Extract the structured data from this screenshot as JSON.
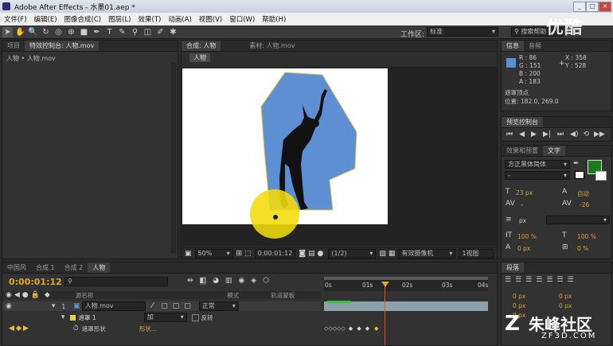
{
  "app": {
    "title": "Adobe After Effects - 水墨01.aep *"
  },
  "menu": [
    "文件(F)",
    "编辑(E)",
    "图像合成(C)",
    "图层(L)",
    "效果(T)",
    "动画(A)",
    "视图(V)",
    "窗口(W)",
    "帮助(H)"
  ],
  "toolbar": {
    "workspace_label": "工作区:",
    "workspace_value": "标准",
    "search_placeholder": "搜索帮助"
  },
  "project": {
    "tab_project": "项目",
    "tab_effects": "特效控制台: 人物.mov",
    "breadcrumb": "人物 • 人物.mov"
  },
  "composition": {
    "tab_comp": "合成: 人物",
    "tab_footage": "素材: 人物.mov",
    "comp_label": "人物",
    "zoom": "50%",
    "timecode": "0:00:01:12",
    "resolution": "(1/2)",
    "camera": "有效摄像机",
    "views": "1视图"
  },
  "info": {
    "tab_info": "信息",
    "tab_audio": "音频",
    "r": "R : 86",
    "g": "G : 151",
    "b": "B : 200",
    "a": "A : 183",
    "x": "X : 358",
    "y": "Y : 528",
    "status_title": "遮罩顶点",
    "status_pos": "位置: 182.0, 269.0",
    "swatch_color": "#5a8fd6"
  },
  "preview": {
    "title": "预览控制台"
  },
  "character": {
    "tab_effects": "效果和预置",
    "tab_text": "文字",
    "font": "方正黑体简体",
    "style": "-",
    "size": "23 px",
    "leading": "自动",
    "kerning": "-",
    "tracking": "-26",
    "unit": "px",
    "vscale": "100 %",
    "hscale": "100 %",
    "baseline": "0 px",
    "tsume": "0 %",
    "fill_color": "#1a7a1a"
  },
  "timeline": {
    "tabs": [
      "中国风",
      "合成 1",
      "合成 2",
      "人物"
    ],
    "timecode": "0:00:01:12",
    "col_layer_name": "源名称",
    "col_mode": "模式",
    "col_trkmat": "轨道蒙板",
    "ticks": [
      "0s",
      "01s",
      "02s",
      "03s",
      "04s"
    ],
    "layer_num": "1",
    "layer_name": "人物.mov",
    "layer_mode": "正常",
    "mask_name": "遮罩 1",
    "mask_mode": "加",
    "mask_invert": "反转",
    "mask_shape": "遮罩形状",
    "mask_shape_value": "形状..."
  },
  "paragraph": {
    "title": "段落",
    "v1": "0 px",
    "v2": "0 px",
    "v3": "0 px",
    "v4": "0 px",
    "v5": "0 px"
  },
  "watermark": {
    "youku": "优酷",
    "brand": "朱峰社区",
    "url": "ZF3D.COM"
  }
}
